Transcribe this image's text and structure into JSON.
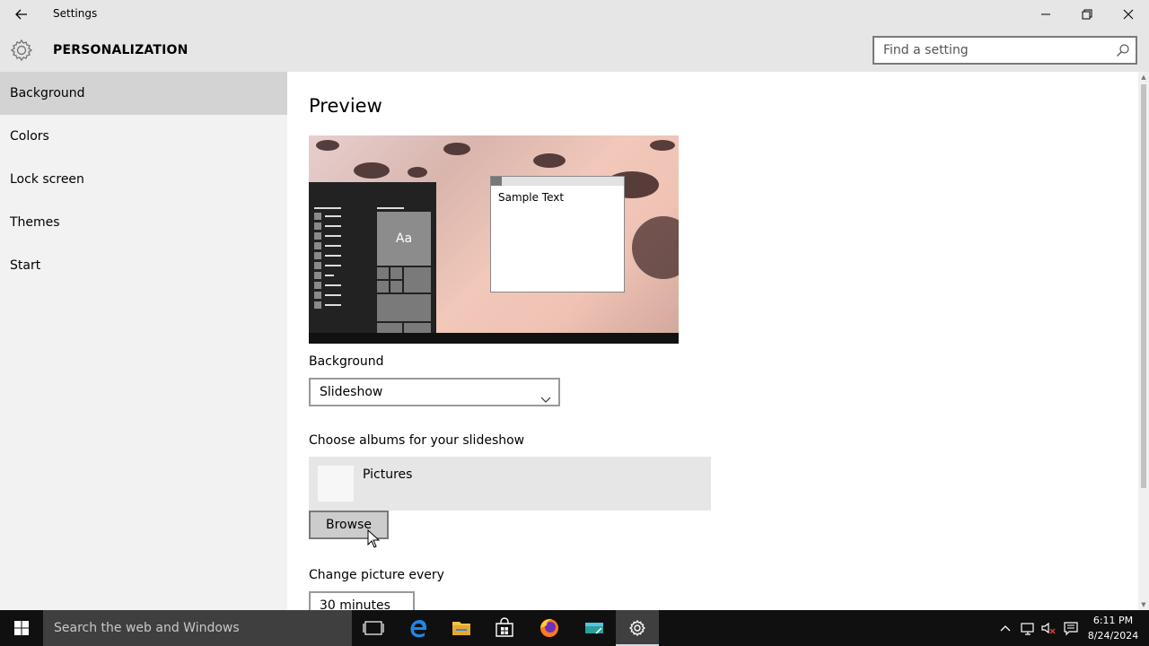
{
  "window": {
    "title": "Settings",
    "back_icon": "back-arrow-icon",
    "controls": [
      "minimize-icon",
      "restore-icon",
      "close-icon"
    ]
  },
  "header": {
    "icon": "gear-icon",
    "title": "PERSONALIZATION",
    "search_placeholder": "Find a setting",
    "search_icon": "search-icon"
  },
  "sidebar": {
    "items": [
      {
        "label": "Background",
        "active": true
      },
      {
        "label": "Colors",
        "active": false
      },
      {
        "label": "Lock screen",
        "active": false
      },
      {
        "label": "Themes",
        "active": false
      },
      {
        "label": "Start",
        "active": false
      }
    ]
  },
  "main": {
    "heading": "Preview",
    "preview": {
      "tile_text": "Aa",
      "window_text": "Sample Text"
    },
    "background_label": "Background",
    "background_value": "Slideshow",
    "albums_label": "Choose albums for your slideshow",
    "album_name": "Pictures",
    "browse_label": "Browse",
    "interval_label": "Change picture every",
    "interval_value": "30 minutes"
  },
  "taskbar": {
    "search_placeholder": "Search the web and Windows",
    "apps": [
      "task-view-icon",
      "edge-icon",
      "file-explorer-icon",
      "store-icon",
      "firefox-icon",
      "app-icon",
      "settings-icon"
    ],
    "active_app": "settings-icon",
    "tray": [
      "chevron-up-icon",
      "network-icon",
      "volume-muted-icon",
      "action-center-icon"
    ],
    "time": "6:11 PM",
    "date": "8/24/2024"
  },
  "colors": {
    "titlebar_bg": "#e6e6e6",
    "sidebar_bg": "#f2f2f2",
    "sidebar_active": "#d3d3d3",
    "taskbar_bg": "#101010",
    "button_bg": "#cccccc"
  }
}
